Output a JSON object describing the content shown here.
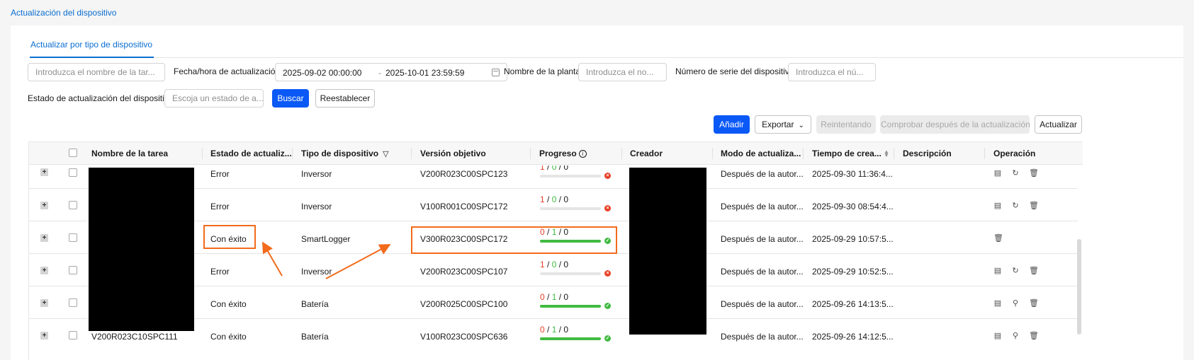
{
  "page": {
    "title": "Actualización del dispositivo"
  },
  "tabs": [
    {
      "label": "Actualizar por tipo de dispositivo",
      "active": true
    }
  ],
  "filters": {
    "task_name_placeholder": "Introduzca el nombre de la tar...",
    "date_label": "Fecha/hora de actualización",
    "date_start": "2025-09-02 00:00:00",
    "date_sep": "-",
    "date_end": "2025-10-01 23:59:59",
    "plant_label": "Nombre de la planta",
    "plant_placeholder": "Introduzca el no...",
    "serial_label": "Número de serie del dispositivo",
    "serial_placeholder": "Introduzca el nú...",
    "status_label": "Estado de actualización del dispositivo",
    "status_placeholder": "Escoja un estado de a...",
    "search_label": "Buscar",
    "reset_label": "Reestablecer"
  },
  "toolbar": {
    "add_label": "Añadir",
    "export_label": "Exportar",
    "retry_label": "Reintentando",
    "check_label": "Comprobar después de la actualización",
    "refresh_label": "Actualizar"
  },
  "table": {
    "columns": {
      "task_name": "Nombre de la tarea",
      "status": "Estado de actualiz...",
      "device_type": "Tipo de dispositivo",
      "target_version": "Versión objetivo",
      "progress": "Progreso",
      "creator": "Creador",
      "mode": "Modo de actualiza...",
      "created": "Tiempo de crea...",
      "description": "Descripción",
      "operation": "Operación"
    },
    "rows": [
      {
        "status": "Error",
        "device_type": "Inversor",
        "version": "V200R023C00SPC123",
        "p1": "1",
        "p2": "0",
        "p3": "0",
        "progress": 0,
        "result": "error",
        "mode": "Después de la autor...",
        "created": "2025-09-30 11:36:4...",
        "ops": [
          "report-icon",
          "retry-icon",
          "delete-icon"
        ]
      },
      {
        "status": "Error",
        "device_type": "Inversor",
        "version": "V100R001C00SPC172",
        "p1": "1",
        "p2": "0",
        "p3": "0",
        "progress": 0,
        "result": "error",
        "mode": "Después de la autor...",
        "created": "2025-09-30 08:54:4...",
        "ops": [
          "report-icon",
          "retry-icon",
          "delete-icon"
        ]
      },
      {
        "status": "Con éxito",
        "device_type": "SmartLogger",
        "version": "V300R023C00SPC172",
        "p1": "0",
        "p2": "1",
        "p3": "0",
        "progress": 1,
        "result": "success",
        "mode": "Después de la autor...",
        "created": "2025-09-29 10:57:5...",
        "ops": [
          "delete-icon"
        ]
      },
      {
        "status": "Error",
        "device_type": "Inversor",
        "version": "V200R023C00SPC107",
        "p1": "1",
        "p2": "0",
        "p3": "0",
        "progress": 0,
        "result": "error",
        "mode": "Después de la autor...",
        "created": "2025-09-29 10:52:5...",
        "ops": [
          "report-icon",
          "retry-icon",
          "delete-icon"
        ]
      },
      {
        "status": "Con éxito",
        "device_type": "Batería",
        "version": "V200R025C00SPC100",
        "p1": "0",
        "p2": "1",
        "p3": "0",
        "progress": 1,
        "result": "success",
        "mode": "Después de la autor...",
        "created": "2025-09-26 14:13:5...",
        "ops": [
          "report-icon",
          "view-icon",
          "delete-icon"
        ]
      },
      {
        "task_name": "V200R023C10SPC111",
        "status": "Con éxito",
        "device_type": "Batería",
        "version": "V100R023C00SPC636",
        "p1": "0",
        "p2": "1",
        "p3": "0",
        "progress": 1,
        "result": "success",
        "mode": "Después de la autor...",
        "created": "2025-09-26 14:12:5...",
        "ops": [
          "report-icon",
          "view-icon",
          "delete-icon"
        ]
      }
    ]
  },
  "colors": {
    "accent": "#0a59f7",
    "link": "#0a6ed1",
    "error": "#e84026",
    "success": "#41ba41",
    "annotation": "#f26a1b"
  }
}
